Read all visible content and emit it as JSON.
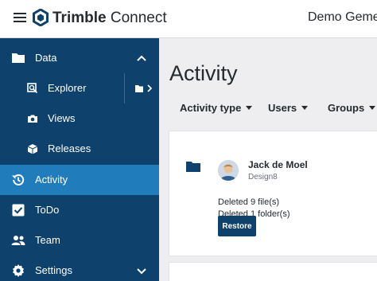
{
  "header": {
    "brand_bold": "Trimble",
    "brand_light": " Connect",
    "project_name": "Demo Gemee"
  },
  "sidebar": {
    "items": [
      {
        "label": "Data",
        "icon": "folder-icon",
        "expanded": true
      },
      {
        "label": "Explorer",
        "icon": "explorer-icon",
        "sub": true
      },
      {
        "label": "Views",
        "icon": "camera-icon",
        "sub": true
      },
      {
        "label": "Releases",
        "icon": "cube-icon",
        "sub": true
      },
      {
        "label": "Activity",
        "icon": "history-icon",
        "active": true
      },
      {
        "label": "ToDo",
        "icon": "checkbox-icon"
      },
      {
        "label": "Team",
        "icon": "people-icon"
      },
      {
        "label": "Settings",
        "icon": "gear-icon",
        "expanded": false
      }
    ]
  },
  "main": {
    "title": "Activity",
    "filters": [
      "Activity type",
      "Users",
      "Groups"
    ],
    "activity": {
      "user_name": "Jack de Moel",
      "user_subtitle": "Design8",
      "details": [
        "Deleted 9 file(s)",
        "Deleted 1 folder(s)"
      ],
      "restore_label": "Restore"
    }
  },
  "colors": {
    "sidebar_bg": "#0e416c",
    "active_bg": "#217cbb",
    "button_bg": "#0e416c",
    "page_bg": "#eeeef0"
  }
}
